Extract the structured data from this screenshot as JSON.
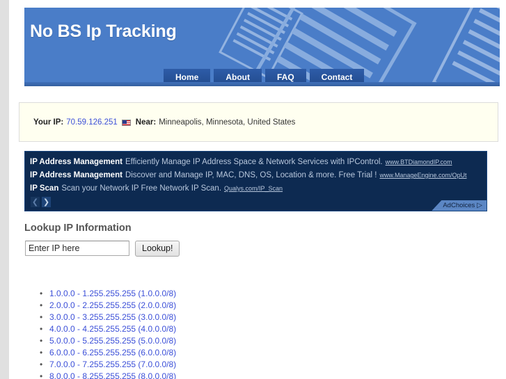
{
  "site": {
    "title": "No BS Ip Tracking"
  },
  "nav": {
    "items": [
      {
        "label": "Home"
      },
      {
        "label": "About"
      },
      {
        "label": "FAQ"
      },
      {
        "label": "Contact"
      }
    ]
  },
  "ip_banner": {
    "your_ip_label": "Your IP:",
    "your_ip_value": "70.59.126.251",
    "flag_icon": "us-flag-icon",
    "near_label": "Near:",
    "near_value": "Minneapolis, Minnesota, United States"
  },
  "ads": {
    "rows": [
      {
        "title": "IP Address Management",
        "description": "Efficiently Manage IP Address Space & Network Services with IPControl.",
        "url": "www.BTDiamondIP.com"
      },
      {
        "title": "IP Address Management",
        "description": "Discover and Manage IP, MAC, DNS, OS, Location & more. Free Trial !",
        "url": "www.ManageEngine.com/OpUt"
      },
      {
        "title": "IP Scan",
        "description": "Scan your Network IP Free Network IP Scan.",
        "url": "Qualys.com/IP_Scan"
      }
    ],
    "prev_arrow": "❮",
    "next_arrow": "❯",
    "adchoices_label": "AdChoices",
    "adchoices_triangle": "▷"
  },
  "lookup": {
    "heading": "Lookup IP Information",
    "input_placeholder": "Enter IP here",
    "input_value": "",
    "button_label": "Lookup!"
  },
  "ip_ranges": {
    "items": [
      "1.0.0.0 - 1.255.255.255 (1.0.0.0/8)",
      "2.0.0.0 - 2.255.255.255 (2.0.0.0/8)",
      "3.0.0.0 - 3.255.255.255 (3.0.0.0/8)",
      "4.0.0.0 - 4.255.255.255 (4.0.0.0/8)",
      "5.0.0.0 - 5.255.255.255 (5.0.0.0/8)",
      "6.0.0.0 - 6.255.255.255 (6.0.0.0/8)",
      "7.0.0.0 - 7.255.255.255 (7.0.0.0/8)",
      "8.0.0.0 - 8.255.255.255 (8.0.0.0/8)"
    ]
  },
  "colors": {
    "header_blue": "#4a7dc8",
    "nav_blue": "#2e5ca8",
    "ad_navy": "#0d2a51",
    "link_blue": "#3b4fd8",
    "banner_cream": "#fffff0",
    "page_gray": "#e0e0e0"
  }
}
